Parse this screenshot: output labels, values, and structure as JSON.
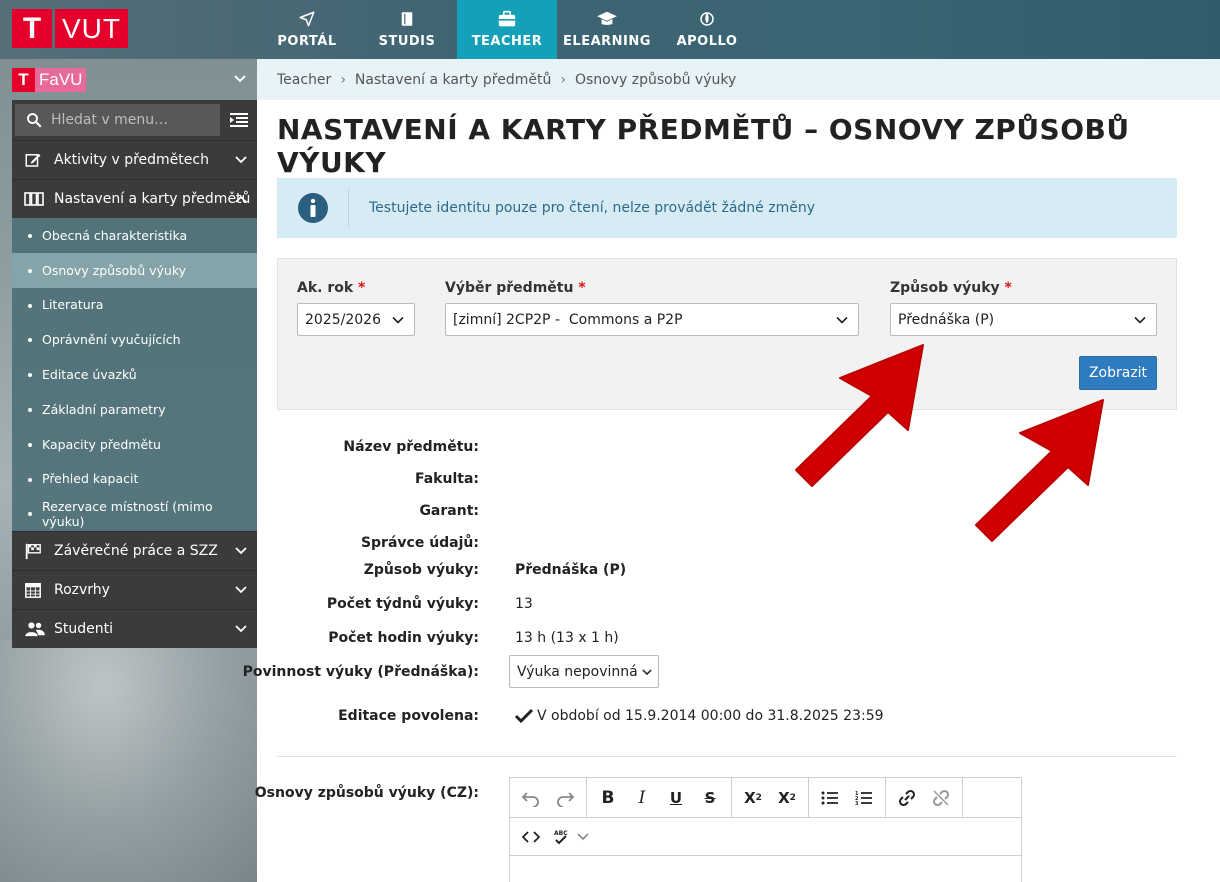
{
  "header": {
    "logo_t": "T",
    "logo_text": "VUT",
    "nav": [
      {
        "label": "PORTÁL",
        "icon": "send-icon"
      },
      {
        "label": "STUDIS",
        "icon": "book-icon"
      },
      {
        "label": "TEACHER",
        "icon": "briefcase-icon",
        "active": true
      },
      {
        "label": "ELEARNING",
        "icon": "graduation-cap-icon"
      },
      {
        "label": "APOLLO",
        "icon": "rocket-icon"
      }
    ]
  },
  "faculty": {
    "badge": "T",
    "name": "FaVU"
  },
  "sidebar": {
    "search_placeholder": "Hledat v menu…",
    "sections": [
      {
        "label": "Aktivity v předmětech",
        "icon": "edit-icon"
      },
      {
        "label": "Nastavení a karty předmětů",
        "icon": "cards-icon",
        "expanded": true
      },
      {
        "label": "Závěrečné práce a SZZ",
        "icon": "flag-icon"
      },
      {
        "label": "Rozvrhy",
        "icon": "calendar-icon"
      },
      {
        "label": "Studenti",
        "icon": "users-icon"
      }
    ],
    "sub_items": [
      "Obecná charakteristika",
      "Osnovy způsobů výuky",
      "Literatura",
      "Oprávnění vyučujících",
      "Editace úvazků",
      "Základní parametry",
      "Kapacity předmětu",
      "Přehled kapacit",
      "Rezervace místností (mimo výuku)"
    ],
    "active_sub": 1
  },
  "breadcrumb": [
    "Teacher",
    "Nastavení a karty předmětů",
    "Osnovy způsobů výuky"
  ],
  "page_title": "NASTAVENÍ A KARTY PŘEDMĚTŮ – OSNOVY ZPŮSOBŮ VÝUKY",
  "alert": {
    "text": "Testujete identitu pouze pro čtení, nelze provádět žádné změny"
  },
  "filter": {
    "year_label": "Ak. rok",
    "year_value": "2025/2026",
    "subject_label": "Výběr předmětu",
    "subject_value": "[zimní] 2CP2P -  Commons a P2P",
    "method_label": "Způsob výuky",
    "method_value": "Přednáška (P)",
    "required_mark": "*",
    "submit": "Zobrazit"
  },
  "details": {
    "name_label": "Název předmětu:",
    "faculty_label": "Fakulta:",
    "guarantor_label": "Garant:",
    "admin_label": "Správce údajů:",
    "method_label": "Způsob výuky:",
    "method_value": "Přednáška (P)",
    "weeks_label": "Počet týdnů výuky:",
    "weeks_value": "13",
    "hours_label": "Počet hodin výuky:",
    "hours_value": "13 h (13 x 1 h)",
    "obligation_label": "Povinnost výuky (Přednáška):",
    "obligation_value": "Výuka nepovinná",
    "editing_label": "Editace povolena:",
    "editing_value": "V období od 15.9.2014 00:00 do 31.8.2025 23:59",
    "syllabus_label": "Osnovy způsobů výuky (CZ):"
  },
  "colors": {
    "accent": "#14a0b8",
    "brand": "#e4002b",
    "button": "#2f7bbf",
    "arrow": "#d10000"
  }
}
